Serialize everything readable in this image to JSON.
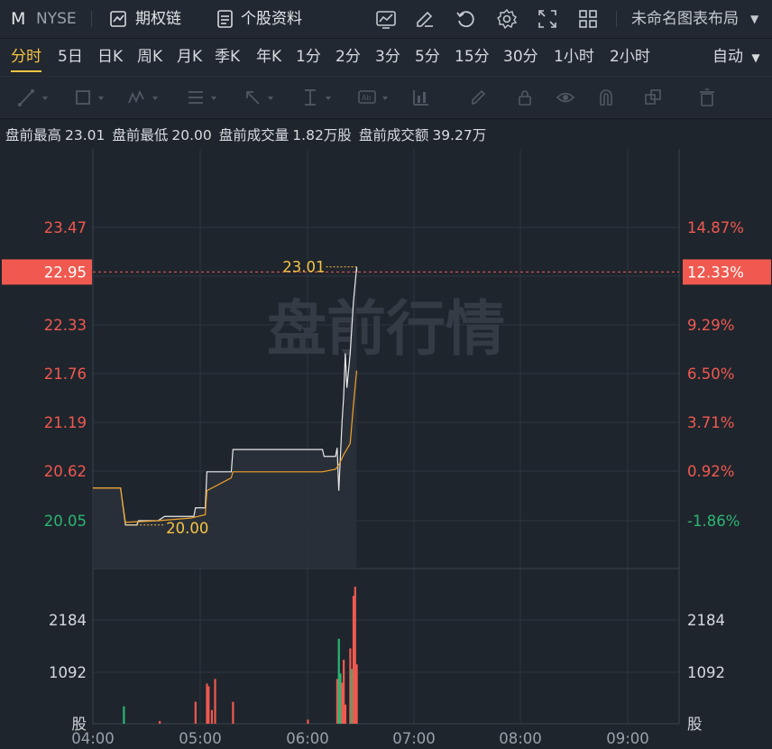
{
  "header": {
    "symbol": "M",
    "exchange": "NYSE",
    "options_chain": "期权链",
    "stock_info": "个股资料",
    "layout_name": "未命名图表布局",
    "icons": [
      "line-chart-icon",
      "edit-icon",
      "refresh-icon",
      "settings-icon",
      "fullscreen-icon",
      "grid-layout-icon"
    ]
  },
  "periods": [
    "分时",
    "5日",
    "日K",
    "周K",
    "月K",
    "季K",
    "年K",
    "1分",
    "2分",
    "3分",
    "5分",
    "15分",
    "30分",
    "1小时",
    "2小时"
  ],
  "active_period": "分时",
  "auto_label": "自动",
  "drawing_tools": [
    "trend-line-icon",
    "rectangle-icon",
    "pattern-icon",
    "fib-icon",
    "arrow-icon",
    "measure-icon",
    "text-icon",
    "chart-type-icon",
    "brush-icon",
    "lock-icon",
    "eye-icon",
    "magnet-icon",
    "layers-icon",
    "trash-icon"
  ],
  "premarket": {
    "high_label": "盘前最高",
    "high_value": "23.01",
    "low_label": "盘前最低",
    "low_value": "20.00",
    "volume_label": "盘前成交量",
    "volume_value": "1.82万股",
    "amount_label": "盘前成交额",
    "amount_value": "39.27万"
  },
  "watermark": "盘前行情",
  "colors": {
    "up": "#f0594f",
    "down": "#2bb673",
    "price_line": "#e9e9e9",
    "avg_line": "#f0a22b",
    "highlight": "#f5c443",
    "background": "#1f252d"
  },
  "chart_data": {
    "type": "line",
    "x_ticks": [
      "04:00",
      "05:00",
      "06:00",
      "07:00",
      "08:00",
      "09:00"
    ],
    "price_ticks": [
      "23.47",
      "22.95",
      "22.33",
      "21.76",
      "21.19",
      "20.62",
      "20.05"
    ],
    "pct_ticks": [
      "14.87%",
      "12.33%",
      "9.29%",
      "6.50%",
      "3.71%",
      "0.92%",
      "-1.86%"
    ],
    "current_price": "22.95",
    "current_pct": "12.33%",
    "max_annotation": "23.01",
    "min_annotation": "20.00",
    "volume_ticks": [
      "2184",
      "1092"
    ],
    "volume_unit": "股",
    "price_series": [
      {
        "t": "04:00",
        "v": 20.43
      },
      {
        "t": "04:17",
        "v": 20.43
      },
      {
        "t": "04:20",
        "v": 20.0
      },
      {
        "t": "04:27",
        "v": 20.0
      },
      {
        "t": "04:28",
        "v": 20.05
      },
      {
        "t": "04:40",
        "v": 20.05
      },
      {
        "t": "04:44",
        "v": 20.1
      },
      {
        "t": "05:02",
        "v": 20.1
      },
      {
        "t": "05:03",
        "v": 20.2
      },
      {
        "t": "05:09",
        "v": 20.2
      },
      {
        "t": "05:10",
        "v": 20.62
      },
      {
        "t": "05:25",
        "v": 20.62
      },
      {
        "t": "05:26",
        "v": 20.88
      },
      {
        "t": "06:21",
        "v": 20.88
      },
      {
        "t": "06:22",
        "v": 20.8
      },
      {
        "t": "06:29",
        "v": 20.8
      },
      {
        "t": "06:30",
        "v": 20.9
      },
      {
        "t": "06:31",
        "v": 20.4
      },
      {
        "t": "06:33",
        "v": 21.2
      },
      {
        "t": "06:34",
        "v": 21.5
      },
      {
        "t": "06:35",
        "v": 22.0
      },
      {
        "t": "06:36",
        "v": 21.6
      },
      {
        "t": "06:38",
        "v": 22.0
      },
      {
        "t": "06:40",
        "v": 22.6
      },
      {
        "t": "06:42",
        "v": 23.01
      },
      {
        "t": "06:42",
        "v": 22.95
      }
    ],
    "avg_series": [
      {
        "t": "04:00",
        "v": 20.43
      },
      {
        "t": "04:17",
        "v": 20.43
      },
      {
        "t": "04:20",
        "v": 20.03
      },
      {
        "t": "04:40",
        "v": 20.05
      },
      {
        "t": "05:00",
        "v": 20.08
      },
      {
        "t": "05:09",
        "v": 20.12
      },
      {
        "t": "05:10",
        "v": 20.4
      },
      {
        "t": "05:25",
        "v": 20.55
      },
      {
        "t": "05:26",
        "v": 20.62
      },
      {
        "t": "06:21",
        "v": 20.62
      },
      {
        "t": "06:29",
        "v": 20.65
      },
      {
        "t": "06:31",
        "v": 20.7
      },
      {
        "t": "06:34",
        "v": 20.82
      },
      {
        "t": "06:38",
        "v": 20.95
      },
      {
        "t": "06:40",
        "v": 21.4
      },
      {
        "t": "06:42",
        "v": 21.8
      }
    ],
    "volume_bars": [
      {
        "t": "04:19",
        "v": 380,
        "dir": "down"
      },
      {
        "t": "04:41",
        "v": 60,
        "dir": "up"
      },
      {
        "t": "05:03",
        "v": 480,
        "dir": "up"
      },
      {
        "t": "05:10",
        "v": 880,
        "dir": "up"
      },
      {
        "t": "05:11",
        "v": 820,
        "dir": "up"
      },
      {
        "t": "05:13",
        "v": 300,
        "dir": "up"
      },
      {
        "t": "05:15",
        "v": 980,
        "dir": "up"
      },
      {
        "t": "05:26",
        "v": 480,
        "dir": "up"
      },
      {
        "t": "06:12",
        "v": 90,
        "dir": "up"
      },
      {
        "t": "06:30",
        "v": 980,
        "dir": "up"
      },
      {
        "t": "06:31",
        "v": 1860,
        "dir": "down"
      },
      {
        "t": "06:32",
        "v": 1100,
        "dir": "down"
      },
      {
        "t": "06:33",
        "v": 900,
        "dir": "up"
      },
      {
        "t": "06:34",
        "v": 1400,
        "dir": "up"
      },
      {
        "t": "06:35",
        "v": 420,
        "dir": "up"
      },
      {
        "t": "06:38",
        "v": 1650,
        "dir": "up"
      },
      {
        "t": "06:39",
        "v": 1200,
        "dir": "down"
      },
      {
        "t": "06:40",
        "v": 2800,
        "dir": "up"
      },
      {
        "t": "06:41",
        "v": 3000,
        "dir": "up"
      },
      {
        "t": "06:42",
        "v": 1300,
        "dir": "up"
      }
    ]
  }
}
